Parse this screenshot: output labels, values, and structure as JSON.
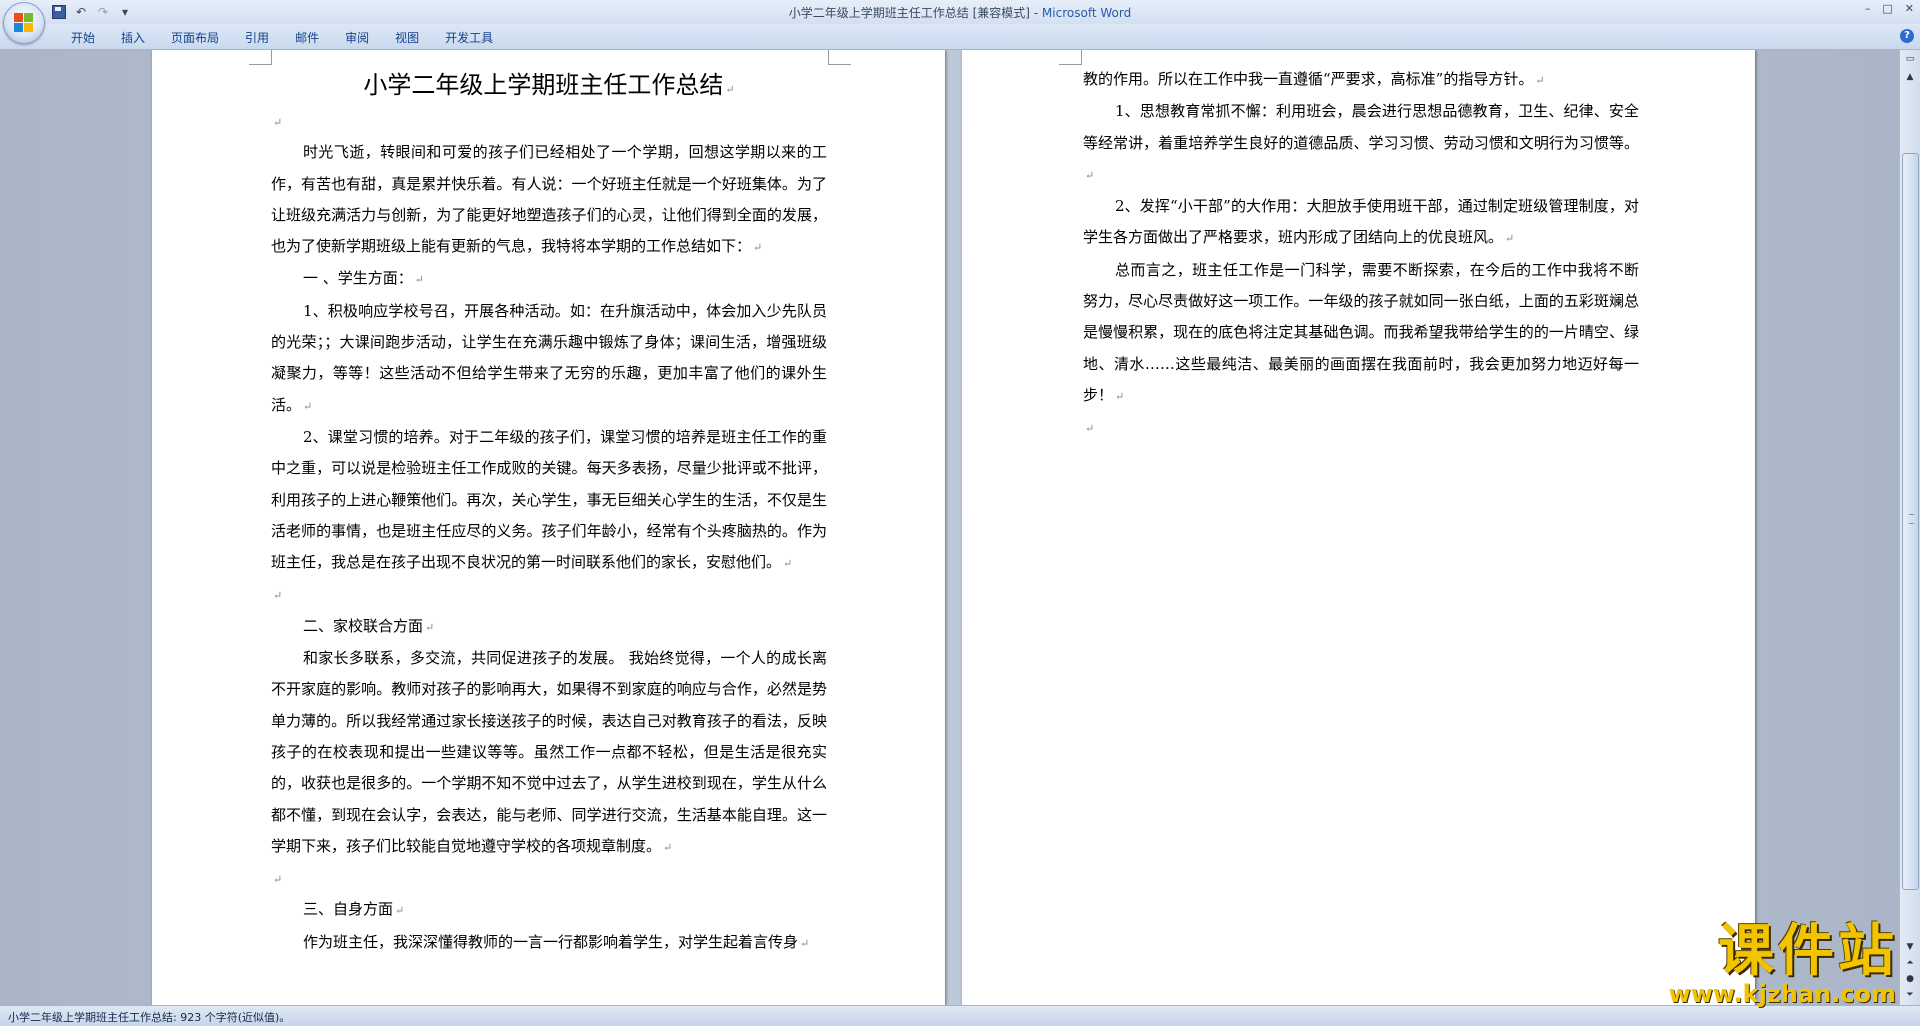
{
  "window": {
    "title": "小学二年级上学期班主任工作总结 [兼容模式] - ",
    "app_name": "Microsoft Word",
    "controls": [
      "–",
      "□",
      "✕"
    ]
  },
  "qat": {
    "save_icon": "save-icon",
    "undo_icon": "undo-icon",
    "redo_icon": "redo-icon",
    "customize_icon": "dropdown-icon"
  },
  "ribbon": {
    "tabs": [
      "开始",
      "插入",
      "页面布局",
      "引用",
      "邮件",
      "审阅",
      "视图",
      "开发工具"
    ],
    "help": "?"
  },
  "document": {
    "title": "小学二年级上学期班主任工作总结",
    "left_page": [
      {
        "t": "",
        "indent": false
      },
      {
        "t": "时光飞逝，转眼间和可爱的孩子们已经相处了一个学期，回想这学期以来的工作，有苦也有甜，真是累并快乐着。有人说：一个好班主任就是一个好班集体。为了让班级充满活力与创新，为了能更好地塑造孩子们的心灵，让他们得到全面的发展，也为了使新学期班级上能有更新的气息，我特将本学期的工作总结如下：",
        "indent": true
      },
      {
        "t": "一 、学生方面：",
        "indent": true
      },
      {
        "t": "1、积极响应学校号召，开展各种活动。如：在升旗活动中，体会加入少先队员的光荣；；大课间跑步活动，让学生在充满乐趣中锻炼了身体；课间生活，增强班级凝聚力，等等！这些活动不但给学生带来了无穷的乐趣，更加丰富了他们的课外生活。",
        "indent": true
      },
      {
        "t": "2、课堂习惯的培养。对于二年级的孩子们，课堂习惯的培养是班主任工作的重中之重，可以说是检验班主任工作成败的关键。每天多表扬，尽量少批评或不批评，利用孩子的上进心鞭策他们。再次，关心学生，事无巨细关心学生的生活，不仅是生活老师的事情，也是班主任应尽的义务。孩子们年龄小，经常有个头疼脑热的。作为班主任，我总是在孩子出现不良状况的第一时间联系他们的家长，安慰他们。",
        "indent": true
      },
      {
        "t": "",
        "indent": false
      },
      {
        "t": "二、家校联合方面",
        "indent": true
      },
      {
        "t": "和家长多联系，多交流，共同促进孩子的发展。 我始终觉得，一个人的成长离不开家庭的影响。教师对孩子的影响再大，如果得不到家庭的响应与合作，必然是势单力薄的。所以我经常通过家长接送孩子的时候，表达自己对教育孩子的看法，反映孩子的在校表现和提出一些建议等等。虽然工作一点都不轻松，但是生活是很充实的，收获也是很多的。一个学期不知不觉中过去了，从学生进校到现在，学生从什么都不懂，到现在会认字，会表达，能与老师、同学进行交流，生活基本能自理。这一学期下来，孩子们比较能自觉地遵守学校的各项规章制度。",
        "indent": true
      },
      {
        "t": "",
        "indent": false
      },
      {
        "t": "三、自身方面",
        "indent": true
      },
      {
        "t": "作为班主任，我深深懂得教师的一言一行都影响着学生，对学生起着言传身",
        "indent": true
      }
    ],
    "right_page": [
      {
        "t": "教的作用。所以在工作中我一直遵循“严要求，高标准”的指导方针。",
        "indent": false
      },
      {
        "t": "1、思想教育常抓不懈：利用班会，晨会进行思想品德教育，卫生、纪律、安全等经常讲，着重培养学生良好的道德品质、学习习惯、劳动习惯和文明行为习惯等。",
        "indent": true
      },
      {
        "t": "2、发挥“小干部”的大作用：大胆放手使用班干部，通过制定班级管理制度，对学生各方面做出了严格要求，班内形成了团结向上的优良班风。",
        "indent": true
      },
      {
        "t": "总而言之，班主任工作是一门科学，需要不断探索，在今后的工作中我将不断努力，尽心尽责做好这一项工作。一年级的孩子就如同一张白纸，上面的五彩斑斓总是慢慢积累，现在的底色将注定其基础色调。而我希望我带给学生的的一片晴空、绿地、清水……这些最纯洁、最美丽的画面摆在我面前时，我会更加努力地迈好每一步！",
        "indent": true
      },
      {
        "t": "",
        "indent": false
      }
    ],
    "paragraph_mark": "↵"
  },
  "status": {
    "text": "小学二年级上学期班主任工作总结: 923 个字符(近似值)。"
  },
  "watermark": {
    "main": "课件站",
    "url": "www.kjzhan.com"
  }
}
